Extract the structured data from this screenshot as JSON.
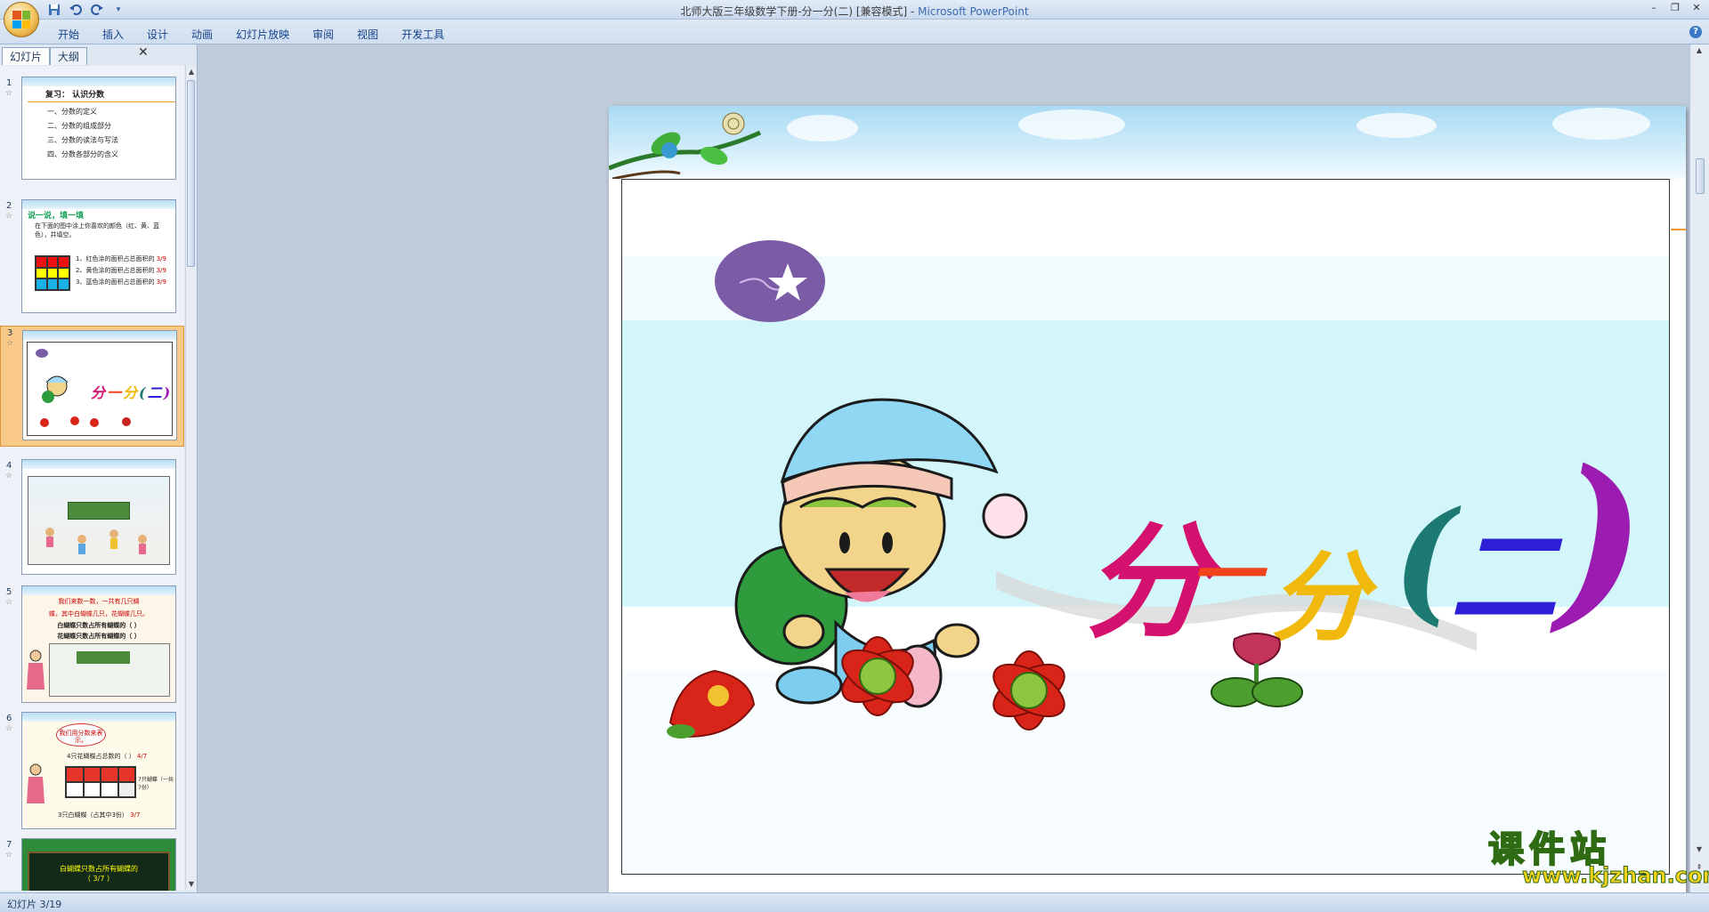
{
  "window": {
    "document_title": "北师大版三年级数学下册-分一分(二) [兼容模式]",
    "separator": " - ",
    "app_name": "Microsoft PowerPoint"
  },
  "ribbon": {
    "tabs": [
      "开始",
      "插入",
      "设计",
      "动画",
      "幻灯片放映",
      "审阅",
      "视图",
      "开发工具"
    ]
  },
  "left_pane": {
    "tabs": [
      "幻灯片",
      "大纲"
    ],
    "thumbnails": [
      {
        "number": "1",
        "title": "复习：        认识分数",
        "lines": [
          "一、分数的定义",
          "二、分数的组成部分",
          "三、分数的读法与写法",
          "四、分数各部分的含义"
        ]
      },
      {
        "number": "2",
        "heading": "说一说，填一填",
        "instruction": "在下面的图中涂上你喜欢的颜色（红、黄、蓝色），并填空。",
        "lines": [
          "1、红色涂的面积占总面积的",
          "2、黄色涂的面积占总面积的",
          "3、蓝色涂的面积占总面积的"
        ],
        "fractions": [
          "3/9",
          "3/9",
          "3/9"
        ]
      },
      {
        "number": "3"
      },
      {
        "number": "4"
      },
      {
        "number": "5",
        "lines": [
          "我们来数一数，一共有几只蝴",
          "蝶，其中白蝴蝶几只，花蝴蝶几只。",
          "白蝴蝶只数占所有蝴蝶的（    ）",
          "花蝴蝶只数占所有蝴蝶的（    ）"
        ]
      },
      {
        "number": "6",
        "bubble": "我们用分数来表示。",
        "lines": [
          "4只花蝴蝶占总数的（    ）",
          "7只蝴蝶（一共7份）",
          "3只白蝴蝶（占其中3份）"
        ],
        "fractions": [
          "4/7",
          "3/7"
        ]
      },
      {
        "number": "7",
        "lines": [
          "白蝴蝶只数占所有蝴蝶的",
          "（  3/7  ）"
        ]
      }
    ]
  },
  "slide": {
    "title_chars": [
      "分",
      "一",
      "分",
      "(",
      "二",
      ")"
    ]
  },
  "status_bar": {
    "text": "幻灯片 3/19"
  },
  "watermark": {
    "title": "课件站",
    "url": "www.kjzhan.com"
  },
  "colors": {
    "title_fen1": "#d4116f",
    "title_yi": "#f2441c",
    "title_fen2": "#f0b90b",
    "title_paren1": "#1c7a73",
    "title_er": "#2d1fd6",
    "title_paren2": "#9c1bb0",
    "selection": "#f9c987"
  },
  "icons": [
    "office-logo",
    "save-icon",
    "undo-icon",
    "redo-icon",
    "customize-qat-icon",
    "minimize-icon",
    "restore-icon",
    "close-icon",
    "help-icon",
    "pane-close-icon"
  ]
}
